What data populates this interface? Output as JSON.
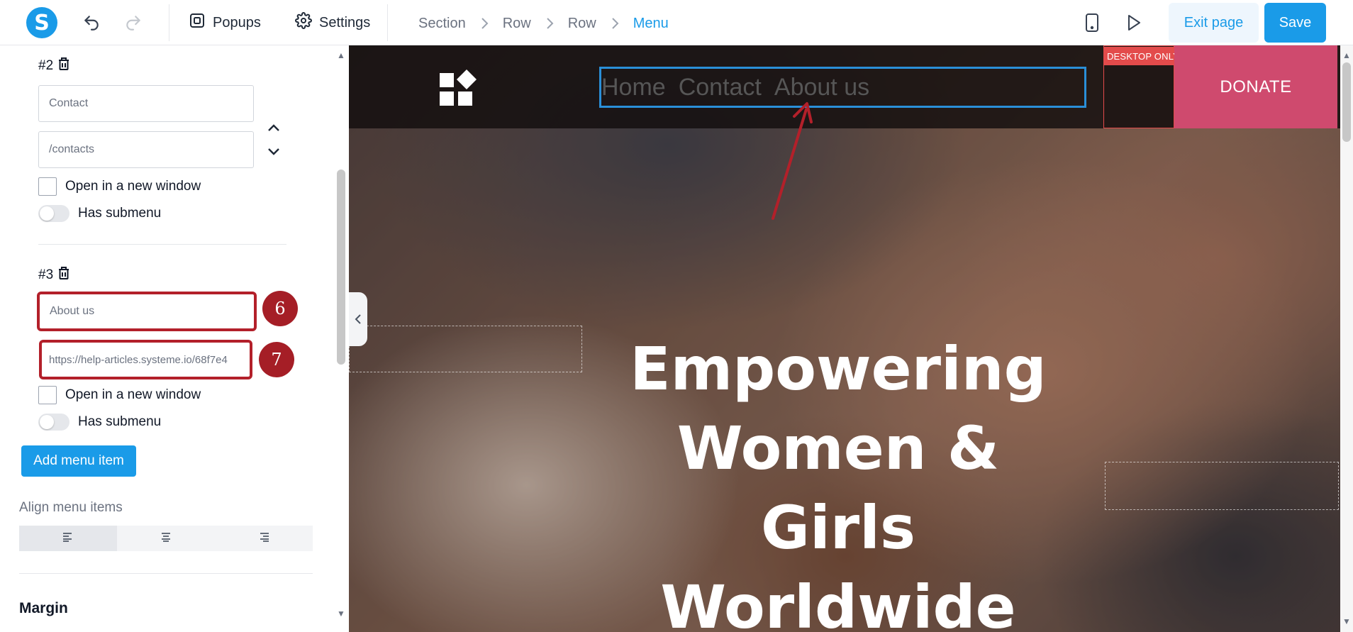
{
  "toolbar": {
    "popups_label": "Popups",
    "settings_label": "Settings",
    "breadcrumbs": [
      "Section",
      "Row",
      "Row",
      "Menu"
    ],
    "exit_label": "Exit page",
    "save_label": "Save",
    "accent_color": "#1a9be8",
    "logo_letter": "S"
  },
  "panel": {
    "item2": {
      "heading": "#2",
      "title_value": "Contact",
      "url_value": "/contacts",
      "new_window_label": "Open in a new window",
      "submenu_label": "Has submenu"
    },
    "item3": {
      "heading": "#3",
      "title_value": "About us",
      "url_value": "https://help-articles.systeme.io/68f7e4",
      "new_window_label": "Open in a new window",
      "submenu_label": "Has submenu"
    },
    "badges": [
      "6",
      "7"
    ],
    "add_menu_item_label": "Add menu item",
    "align_label": "Align menu items",
    "align_options": [
      "left",
      "center",
      "right"
    ],
    "align_selected": "left",
    "margin_label": "Margin"
  },
  "canvas": {
    "menu_links": [
      "Home",
      "Contact",
      "About us"
    ],
    "desktop_only_label": "DESKTOP ONLY",
    "donate_label": "DONATE",
    "hero_lines": [
      "Empowering",
      "Women &",
      "Girls",
      "Worldwide"
    ],
    "donate_color": "#cf4a6e",
    "highlight_color": "#b3202a"
  }
}
